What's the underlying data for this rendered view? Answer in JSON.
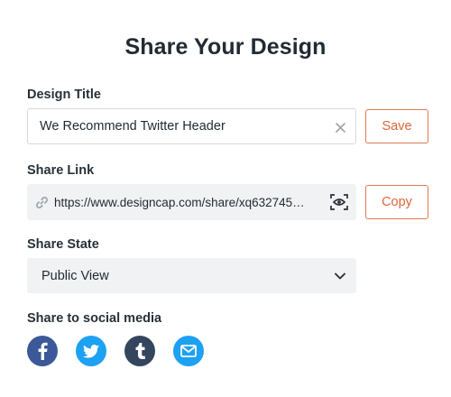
{
  "page": {
    "title": "Share Your Design"
  },
  "design_title": {
    "label": "Design Title",
    "value": "We Recommend Twitter Header",
    "clear_icon": "close-icon",
    "save_label": "Save"
  },
  "share_link": {
    "label": "Share Link",
    "url": "https://www.designcap.com/share/xq632745…",
    "link_icon": "link-icon",
    "preview_icon": "eye-preview-icon",
    "copy_label": "Copy"
  },
  "share_state": {
    "label": "Share State",
    "selected": "Public View",
    "dropdown_icon": "chevron-down-icon"
  },
  "social": {
    "label": "Share to social media",
    "items": [
      {
        "icon": "facebook-icon",
        "color": "#3b5998"
      },
      {
        "icon": "twitter-icon",
        "color": "#1da1f2"
      },
      {
        "icon": "tumblr-icon",
        "color": "#34465d"
      },
      {
        "icon": "email-icon",
        "color": "#1da1f2"
      }
    ]
  },
  "colors": {
    "accent": "#e0653a",
    "heading": "#222b33",
    "field_fill": "#f1f2f4"
  }
}
